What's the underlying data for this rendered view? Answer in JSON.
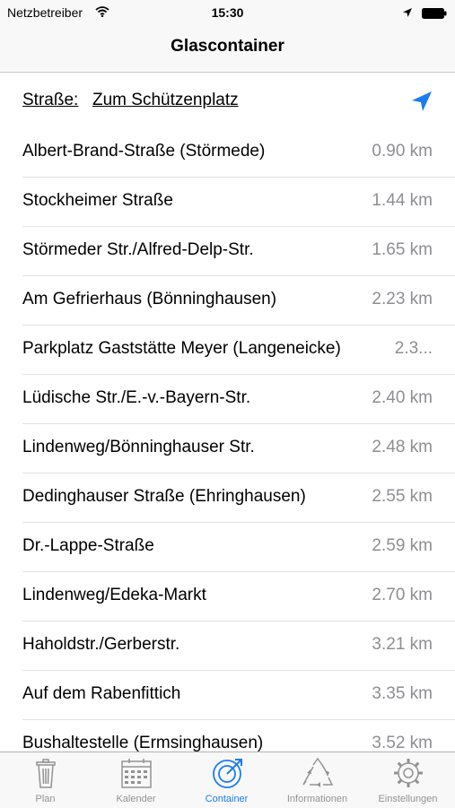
{
  "status_bar": {
    "carrier": "Netzbetreiber",
    "time": "15:30"
  },
  "nav": {
    "title": "Glascontainer"
  },
  "street": {
    "label": "Straße:",
    "value": "Zum Schützenplatz"
  },
  "containers": [
    {
      "name": "Albert-Brand-Straße (Störmede)",
      "distance": "0.90 km"
    },
    {
      "name": "Stockheimer Straße",
      "distance": "1.44 km"
    },
    {
      "name": "Störmeder Str./Alfred-Delp-Str.",
      "distance": "1.65 km"
    },
    {
      "name": "Am Gefrierhaus (Bönninghausen)",
      "distance": "2.23 km"
    },
    {
      "name": "Parkplatz Gaststätte Meyer (Langeneicke)",
      "distance": "2.3..."
    },
    {
      "name": "Lüdische Str./E.-v.-Bayern-Str.",
      "distance": "2.40 km"
    },
    {
      "name": "Lindenweg/Bönninghauser Str.",
      "distance": "2.48 km"
    },
    {
      "name": "Dedinghauser Straße (Ehringhausen)",
      "distance": "2.55 km"
    },
    {
      "name": "Dr.-Lappe-Straße",
      "distance": "2.59 km"
    },
    {
      "name": "Lindenweg/Edeka-Markt",
      "distance": "2.70 km"
    },
    {
      "name": "Haholdstr./Gerberstr.",
      "distance": "3.21 km"
    },
    {
      "name": "Auf dem Rabenfittich",
      "distance": "3.35 km"
    },
    {
      "name": "Bushaltestelle (Ermsinghausen)",
      "distance": "3.52 km"
    }
  ],
  "tabs": [
    {
      "label": "Plan",
      "icon": "trash-bin-icon"
    },
    {
      "label": "Kalender",
      "icon": "calendar-icon"
    },
    {
      "label": "Container",
      "icon": "container-target-icon",
      "active": true
    },
    {
      "label": "Informationen",
      "icon": "recycle-icon"
    },
    {
      "label": "Einstellungen",
      "icon": "gear-icon"
    }
  ],
  "colors": {
    "accent": "#1a7cf2",
    "inactive": "#929292",
    "distance": "#8e8e93"
  }
}
